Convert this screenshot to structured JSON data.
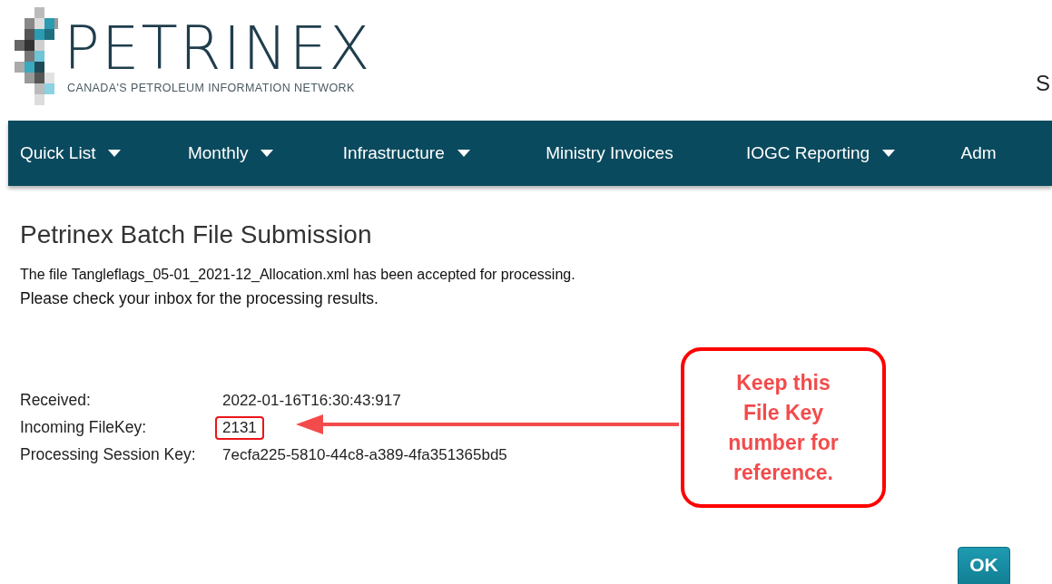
{
  "header": {
    "logo_name": "PETRINEX",
    "logo_tagline": "CANADA'S PETROLEUM INFORMATION NETWORK",
    "right_text": "S"
  },
  "nav": [
    {
      "label": "Quick List",
      "has_menu": true
    },
    {
      "label": "Monthly",
      "has_menu": true
    },
    {
      "label": "Infrastructure",
      "has_menu": true
    },
    {
      "label": "Ministry Invoices",
      "has_menu": false
    },
    {
      "label": "IOGC Reporting",
      "has_menu": true
    },
    {
      "label": "Adm",
      "has_menu": false
    }
  ],
  "page": {
    "title": "Petrinex Batch File Submission",
    "message": [
      "The file Tangleflags_05-01_2021-12_Allocation.xml has been accepted for processing.",
      "Please check your inbox for the processing results."
    ],
    "fields": [
      {
        "label": "Received:",
        "value": "2022-01-16T16:30:43:917",
        "highlighted": false
      },
      {
        "label": "Incoming FileKey:",
        "value": "2131",
        "highlighted": true
      },
      {
        "label": "Processing Session Key:",
        "value": "7ecfa225-5810-44c8-a389-4fa351365bd5",
        "highlighted": false
      }
    ]
  },
  "callout": {
    "text": "Keep this File Key number for reference."
  },
  "buttons": [
    {
      "label": "OK"
    }
  ]
}
